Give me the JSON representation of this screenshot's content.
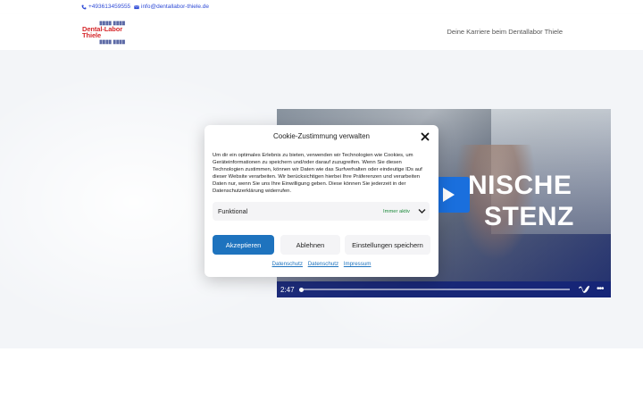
{
  "topbar": {
    "phone": "+493613459555",
    "email": "info@dentallabor-thiele.de"
  },
  "header": {
    "logo": {
      "ornament_top": "▓▓▓▓ ▓▓▓▓",
      "text": "Dental-Labor Thiele",
      "ornament_bottom": "▓▓▓▓ ▓▓▓▓"
    },
    "nav": {
      "career": "Deine Karriere beim Dentallabor Thiele"
    }
  },
  "video": {
    "headline_line1": "NISCHE",
    "headline_line2": "STENZ",
    "time": "2:47",
    "progress": 0.0
  },
  "cookie": {
    "title": "Cookie-Zustimmung verwalten",
    "text": "Um dir ein optimales Erlebnis zu bieten, verwenden wir Technologien wie Cookies, um Geräteinformationen zu speichern und/oder darauf zuzugreifen. Wenn Sie diesen Technologien zustimmen, können wir Daten wie das Surfverhalten oder eindeutige IDs auf dieser Website verarbeiten. Wir berücksichtigen hierbei Ihre Präferenzen und verarbeiten Daten nur, wenn Sie uns Ihre Einwilligung geben. Diese können Sie jederzeit in der Datenschutzerklärung widerrufen.",
    "category": {
      "label": "Funktional",
      "status": "Immer aktiv"
    },
    "buttons": {
      "accept": "Akzeptieren",
      "deny": "Ablehnen",
      "preferences": "Einstellungen speichern"
    },
    "links": [
      "Datenschutz",
      "Datenschutz",
      "Impressum"
    ]
  },
  "colors": {
    "accent": "#1e73be",
    "brand_red": "#d6282b",
    "video_bar": "#142478",
    "active_green": "#1b8a3a"
  }
}
